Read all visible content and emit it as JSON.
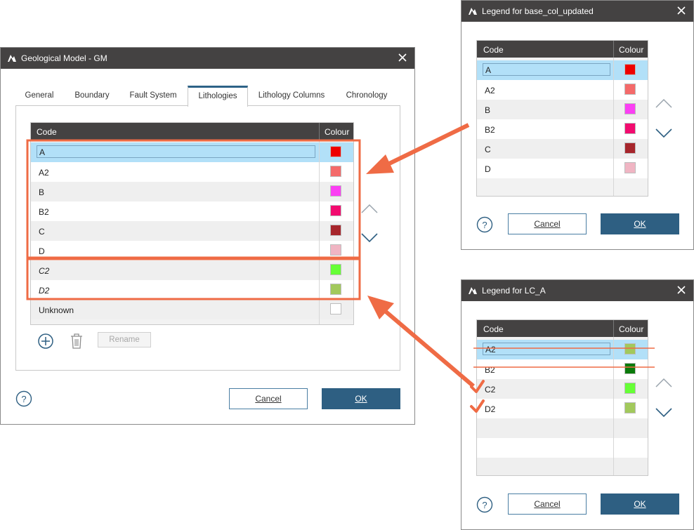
{
  "main_dialog": {
    "title": "Geological Model - GM",
    "tabs": [
      "General",
      "Boundary",
      "Fault System",
      "Lithologies",
      "Lithology Columns",
      "Chronology"
    ],
    "active_tab": "Lithologies",
    "columns": {
      "code": "Code",
      "colour": "Colour"
    },
    "rows": [
      {
        "code": "A",
        "colour": "#ee0000",
        "selected": true,
        "italic": false
      },
      {
        "code": "A2",
        "colour": "#f46a6a",
        "selected": false,
        "italic": false
      },
      {
        "code": "B",
        "colour": "#fb3ff3",
        "selected": false,
        "italic": false
      },
      {
        "code": "B2",
        "colour": "#f20b6f",
        "selected": false,
        "italic": false
      },
      {
        "code": "C",
        "colour": "#a7262c",
        "selected": false,
        "italic": false
      },
      {
        "code": "D",
        "colour": "#f0b5c3",
        "selected": false,
        "italic": false
      },
      {
        "code": "C2",
        "colour": "#66ff36",
        "selected": false,
        "italic": true
      },
      {
        "code": "D2",
        "colour": "#a2c95c",
        "selected": false,
        "italic": true
      },
      {
        "code": "Unknown",
        "colour": "#ffffff",
        "selected": false,
        "italic": false
      }
    ],
    "rename_label": "Rename",
    "cancel_label": "Cancel",
    "ok_label": "OK"
  },
  "legend_base": {
    "title": "Legend for base_col_updated",
    "columns": {
      "code": "Code",
      "colour": "Colour"
    },
    "rows": [
      {
        "code": "A",
        "colour": "#ee0000",
        "selected": true
      },
      {
        "code": "A2",
        "colour": "#f46a6a",
        "selected": false
      },
      {
        "code": "B",
        "colour": "#fb3ff3",
        "selected": false
      },
      {
        "code": "B2",
        "colour": "#f20b6f",
        "selected": false
      },
      {
        "code": "C",
        "colour": "#a7262c",
        "selected": false
      },
      {
        "code": "D",
        "colour": "#f0b5c3",
        "selected": false
      }
    ],
    "cancel_label": "Cancel",
    "ok_label": "OK"
  },
  "legend_lca": {
    "title": "Legend for LC_A",
    "columns": {
      "code": "Code",
      "colour": "Colour"
    },
    "rows": [
      {
        "code": "A2",
        "colour": "#a2c95c",
        "selected": true,
        "struck": true,
        "checked": false
      },
      {
        "code": "B2",
        "colour": "#0a7a0a",
        "selected": false,
        "struck": true,
        "checked": false
      },
      {
        "code": "C2",
        "colour": "#66ff36",
        "selected": false,
        "struck": false,
        "checked": true
      },
      {
        "code": "D2",
        "colour": "#a2c95c",
        "selected": false,
        "struck": false,
        "checked": true
      }
    ],
    "cancel_label": "Cancel",
    "ok_label": "OK"
  },
  "colors": {
    "titlebar": "#444242",
    "accent": "#2e5f82",
    "selection": "#b2e0f8",
    "annotation": "#ef6b45"
  },
  "icons": [
    "app-icon",
    "close-icon",
    "add-icon",
    "delete-icon",
    "move-up-icon",
    "move-down-icon",
    "help-icon",
    "check-icon"
  ]
}
